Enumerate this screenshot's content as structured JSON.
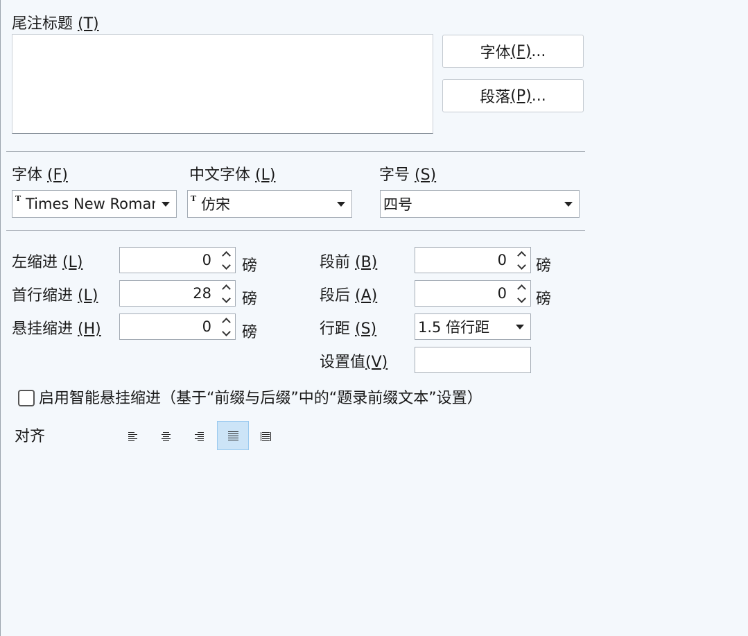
{
  "title_section": {
    "label": "尾注标题 ",
    "key": "(T)",
    "font_button": {
      "label": "字体 ",
      "key": "(F)",
      "suffix": "..."
    },
    "para_button": {
      "label": "段落 ",
      "key": "(P)",
      "suffix": "..."
    }
  },
  "font_row": {
    "font": {
      "label": "字体 ",
      "key": "(F)",
      "value": "Times New Roman"
    },
    "cn_font": {
      "label": "中文字体 ",
      "key": "(L)",
      "value": "仿宋"
    },
    "size": {
      "label": "字号 ",
      "key": "(S)",
      "value": "四号"
    }
  },
  "indent": {
    "left": {
      "label": "左缩进 ",
      "key": "(L)",
      "value": "0",
      "unit": "磅"
    },
    "first": {
      "label": "首行缩进 ",
      "key": "(L)",
      "value": "28",
      "unit": "磅"
    },
    "hanging": {
      "label": "悬挂缩进 ",
      "key": "(H)",
      "value": "0",
      "unit": "磅"
    }
  },
  "spacing": {
    "before": {
      "label": "段前 ",
      "key": "(B)",
      "value": "0",
      "unit": "磅"
    },
    "after": {
      "label": "段后 ",
      "key": "(A)",
      "value": "0",
      "unit": "磅"
    },
    "line": {
      "label": "行距 ",
      "key": "(S)",
      "value": "1.5 倍行距"
    },
    "setting": {
      "label": "设置值",
      "key": "(V)",
      "value": ""
    }
  },
  "smart_hanging": {
    "label": "启用智能悬挂缩进（基于“前缀与后缀”中的“题录前缀文本”设置）",
    "checked": false
  },
  "align": {
    "label": "对齐",
    "selected": "justify",
    "icons": [
      "align-left-icon",
      "align-center-icon",
      "align-right-icon",
      "align-justify-icon",
      "align-distributed-icon"
    ]
  }
}
